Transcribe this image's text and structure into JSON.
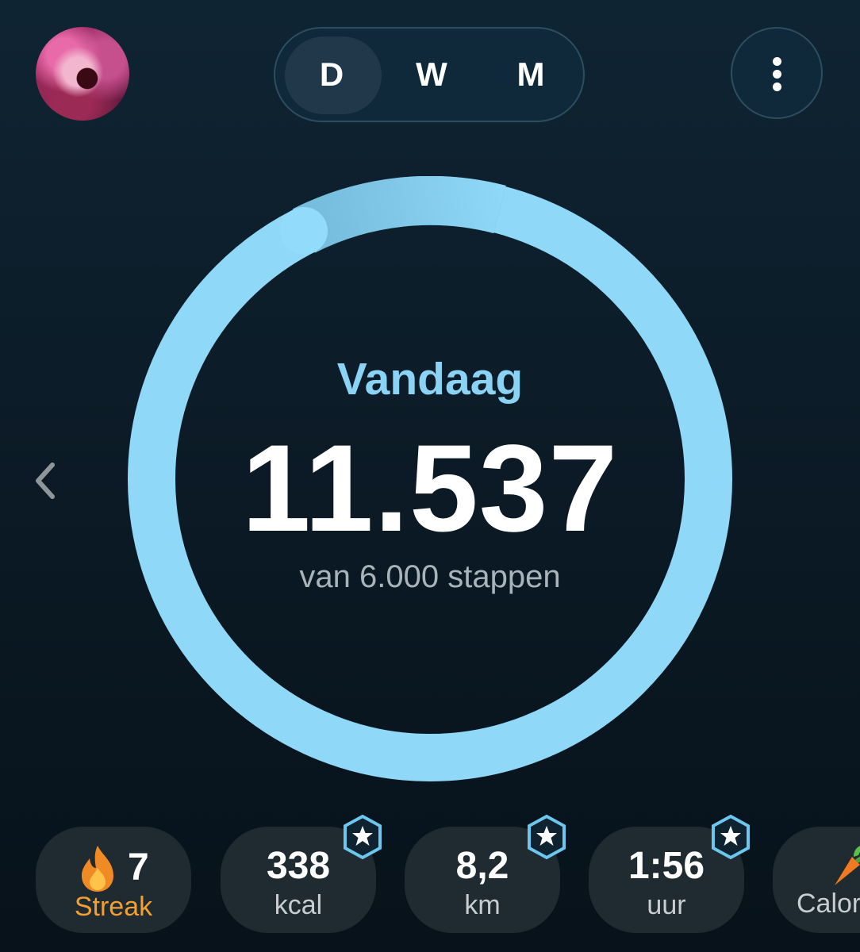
{
  "header": {
    "period_tabs": [
      {
        "label": "D",
        "active": true
      },
      {
        "label": "W",
        "active": false
      },
      {
        "label": "M",
        "active": false
      }
    ],
    "menu_icon": "more-vertical-icon",
    "avatar_icon": "profile-avatar"
  },
  "progress": {
    "title": "Vandaag",
    "steps": "11.537",
    "goal_text": "van 6.000 stappen",
    "fraction": 1.0,
    "ring_color": "#8fd8f8",
    "prev_icon": "chevron-left-icon"
  },
  "stats": {
    "streak": {
      "value": "7",
      "label": "Streak",
      "icon": "flame-icon",
      "label_color": "#f4a031"
    },
    "kcal": {
      "value": "338",
      "label": "kcal",
      "badge": "star-badge-icon"
    },
    "distance": {
      "value": "8,2",
      "label": "km",
      "badge": "star-badge-icon"
    },
    "duration": {
      "value": "1:56",
      "label": "uur",
      "badge": "star-badge-icon"
    },
    "calories_partial": {
      "label": "Calori",
      "icon": "carrot-icon"
    }
  },
  "colors": {
    "accent": "#8bd3f5",
    "background": "#0c1c28",
    "card": "#1f2a31"
  }
}
